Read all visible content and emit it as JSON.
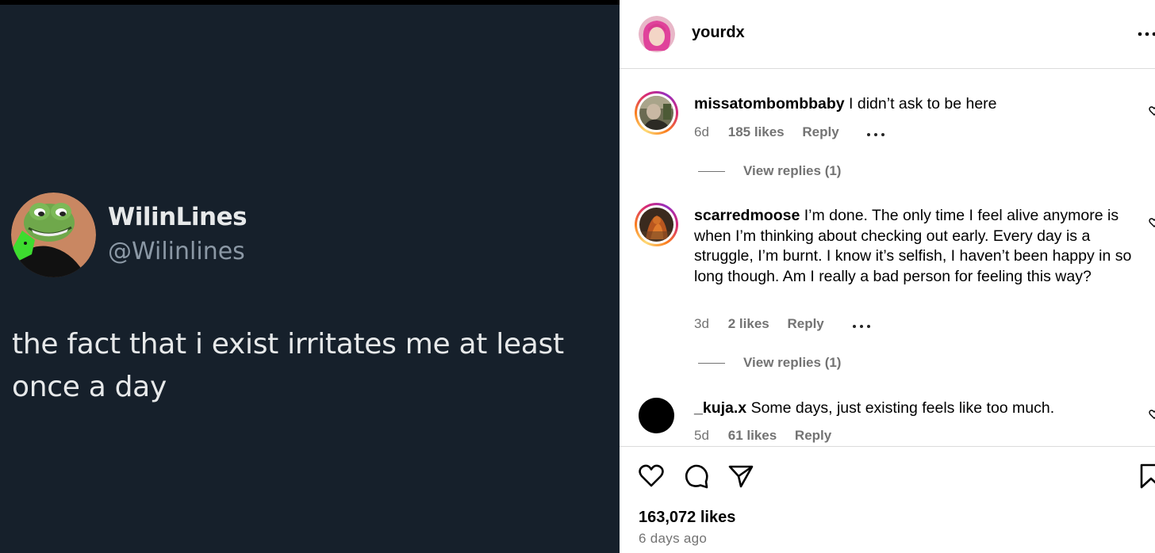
{
  "tweet": {
    "display_name": "WilinLines",
    "handle": "@Wilinlines",
    "text": "the fact that i exist irritates me at least once a day",
    "avatar_icon": "frog-avatar"
  },
  "post": {
    "owner_username": "yourdx",
    "more_icon": "more-horizontal-icon",
    "comments": [
      {
        "username": "missatombombbaby",
        "text": "I didn’t ask to be here",
        "age": "6d",
        "likes": "185 likes",
        "reply_label": "Reply",
        "view_replies": "View replies (1)"
      },
      {
        "username": "scarredmoose",
        "text": "I’m done. The only time I feel alive anymore is when I’m thinking about checking out early. Every day is a struggle, I’m burnt. I know it’s selfish, I haven’t been happy in so long though. Am I really a bad person for feeling this way?",
        "age": "3d",
        "likes": "2 likes",
        "reply_label": "Reply",
        "view_replies": "View replies (1)"
      },
      {
        "username": "_kuja.x",
        "text": "Some days, just existing feels like too much.",
        "age": "5d",
        "likes": "61 likes",
        "reply_label": "Reply"
      }
    ],
    "actions": {
      "like_icon": "heart-icon",
      "comment_icon": "comment-icon",
      "share_icon": "send-icon",
      "save_icon": "bookmark-icon"
    },
    "like_count": "163,072 likes",
    "posted_ago": "6 days ago"
  },
  "colors": {
    "tweet_background": "#16202b",
    "tweet_text": "#e7e9ea",
    "tweet_handle": "#8b98a5",
    "meta_gray": "#737373",
    "story_ring": "#d62976"
  }
}
